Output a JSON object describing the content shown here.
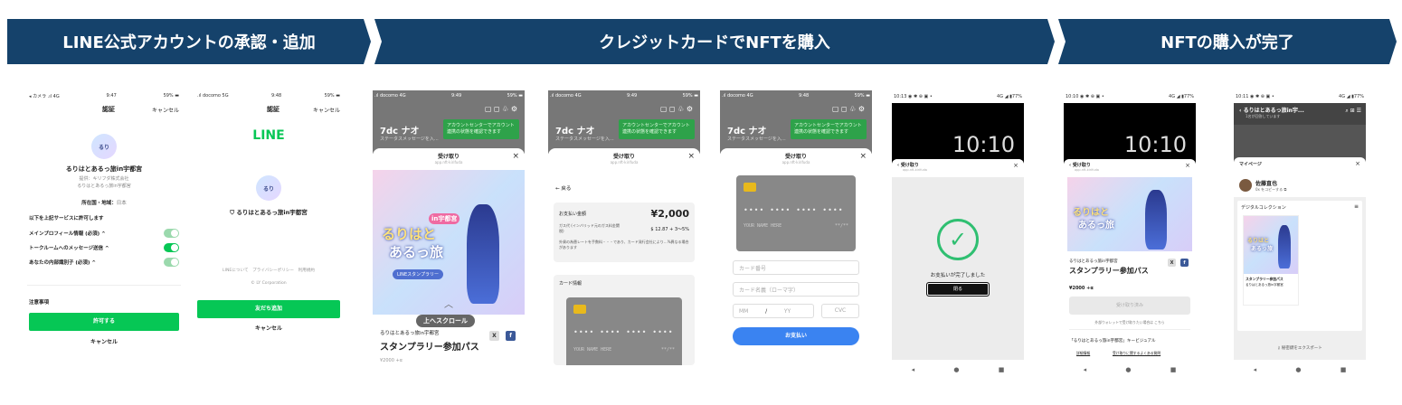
{
  "banners": {
    "step1": "LINE公式アカウントの承認・追加",
    "step2": "クレジットカードでNFTを購入",
    "step3": "NFTの購入が完了"
  },
  "phone1": {
    "status_left": "◂ カメラ .ıl 4G",
    "time": "9:47",
    "battery": "59% ▬",
    "title": "認証",
    "cancel": "キャンセル",
    "account_name": "るりはとあるっ旅in宇都宮",
    "provider": "提供：キリフダ株式会社",
    "subtitle": "るりはとあるっ旅in宇都宮",
    "region_label": "所在国・地域：",
    "region_value": "日本",
    "permission_heading": "以下を上記サービスに許可します",
    "perm1": "メインプロフィール情報 (必須) ^",
    "perm2": "トークルームへのメッセージ送信 ^",
    "perm3": "あなたの内部識別子 (必須) ^",
    "notes": "注意事項",
    "allow": "許可する",
    "cancel_bottom": "キャンセル"
  },
  "phone2": {
    "status_left": ".ıl docomo 5G",
    "time": "9:48",
    "battery": "59% ▬",
    "title": "認証",
    "cancel": "キャンセル",
    "logo": "LINE",
    "account_name": "るりはとあるっ旅in宇都宮",
    "footer_links": "LINEについて　プライバシーポリシー　利用規約",
    "footer_company": "© LY Corporation",
    "add_friend": "友だち追加",
    "cancel_bottom": "キャンセル"
  },
  "wallet_common": {
    "status_left": ".ıl docomo 4G",
    "time_a": "9:49",
    "time_b": "9:48",
    "battery": "59% ▬",
    "profile_name": "7dc ナオ",
    "status_message": "ステータスメッセージを入...",
    "green_notice": "アカウントセンターでアカウント連携の状態を確認できます",
    "sheet_title": "受け取り",
    "sheet_sub": "app.nft-kirifuda",
    "close": "×"
  },
  "phone3": {
    "scroll_up": "上へスクロール",
    "issuer": "るりはとあるっ旅in宇都宮",
    "nft_title": "スタンプラリー参加パス",
    "price_peek": "¥2000 +α",
    "art_line1": "るりはと",
    "art_line2": "あるっ旅",
    "art_badge": "in宇都宮",
    "art_pill": "LINEスタンプラリー"
  },
  "phone4": {
    "back": "← 戻る",
    "amount_label": "お支払い金額",
    "amount": "¥2,000",
    "fee_label": "ガス代 (インバリッド元のガス料金関税)",
    "fee_value": "$ 12.87 + 3～5%",
    "note": "外貨の為替レートを手数料・・・であり、カード発行会社により…%異なる場合があります",
    "card_info": "カード情報",
    "card_number": "•••• •••• •••• ••••",
    "card_name": "YOUR NAME HERE",
    "card_expiry": "**/**"
  },
  "phone5": {
    "card_number": "•••• •••• •••• ••••",
    "card_name": "YOUR NAME HERE",
    "card_expiry": "**/**",
    "field_number": "カード番号",
    "field_name": "カード名義（ローマ字）",
    "field_mm": "MM",
    "field_slash": "/",
    "field_yy": "YY",
    "field_cvc": "CVC",
    "pay_button": "お支払い"
  },
  "phone6": {
    "status_left": "10:13 ◉ ✱ ⊕ ▣ •",
    "status_right": "4G ◢ ▮77%",
    "lock_time": "10:10",
    "sheet_title": "受け取り",
    "sheet_sub": "app.nft-kirifuda",
    "done_text": "お支払いが完了しました",
    "close_button": "閉る"
  },
  "phone7": {
    "status_left": "10:10 ◉ ✱ ⊕ ▣ •",
    "status_right": "4G ◢ ▮77%",
    "lock_time": "10:10",
    "sheet_title": "受け取り",
    "sheet_sub": "app.nft-kirifuda",
    "issuer": "るりはとあるっ旅in宇都宮",
    "nft_title": "スタンプラリー参加パス",
    "price": "¥2000 +α",
    "received_button": "受け取り済み",
    "wallet_note": "外部ウォレットで受け取りたい場合は こちら",
    "official_label": "「るりはとあるっ旅in宇都宮」キービジュアル",
    "detail1": "詳細情報",
    "detail2": "受け取りに関するよくある質問"
  },
  "phone8": {
    "status_left": "10:11 ◉ ✱ ⊕ ▣ •",
    "status_right": "4G ◢ ▮77%",
    "chat_title": "るりはとあるっ旅in宇...",
    "chat_sub": "1名が回答しています",
    "mypage": "マイページ",
    "user_name": "佐藤直也",
    "user_sub": "0x をコピーする ⧉",
    "collection": "デジタルコレクション",
    "item_title": "スタンプラリー参加パス",
    "item_sub": "るりはとあるっ旅in宇都宮",
    "export": "秘密鍵をエクスポート"
  },
  "colors": {
    "banner": "#15426b",
    "line_green": "#06c755",
    "pay_blue": "#3a83f1"
  }
}
